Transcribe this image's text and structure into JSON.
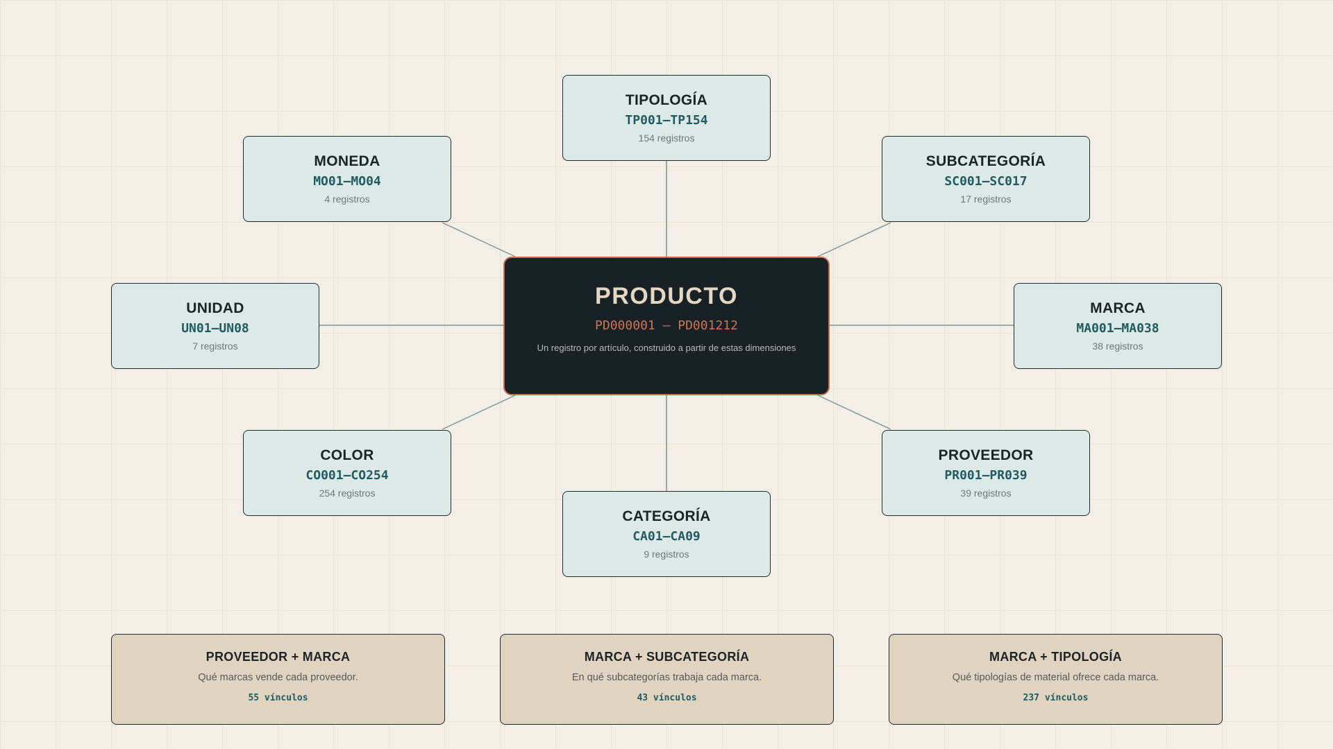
{
  "center": {
    "title": "PRODUCTO",
    "range": "PD000001 – PD001212",
    "description": "Un registro por artículo, construido a partir de estas dimensiones"
  },
  "dimensions": [
    {
      "id": "tipologia",
      "name": "TIPOLOGÍA",
      "range": "TP001–TP154",
      "count": "154 registros"
    },
    {
      "id": "moneda",
      "name": "MONEDA",
      "range": "MO01–MO04",
      "count": "4 registros"
    },
    {
      "id": "subcategoria",
      "name": "SUBCATEGORÍA",
      "range": "SC001–SC017",
      "count": "17 registros"
    },
    {
      "id": "unidad",
      "name": "UNIDAD",
      "range": "UN01–UN08",
      "count": "7 registros"
    },
    {
      "id": "marca",
      "name": "MARCA",
      "range": "MA001–MA038",
      "count": "38 registros"
    },
    {
      "id": "color",
      "name": "COLOR",
      "range": "CO001–CO254",
      "count": "254 registros"
    },
    {
      "id": "proveedor",
      "name": "PROVEEDOR",
      "range": "PR001–PR039",
      "count": "39 registros"
    },
    {
      "id": "categoria",
      "name": "CATEGORÍA",
      "range": "CA01–CA09",
      "count": "9 registros"
    }
  ],
  "relations": [
    {
      "title": "PROVEEDOR + MARCA",
      "description": "Qué marcas vende cada proveedor.",
      "count": "55 vínculos"
    },
    {
      "title": "MARCA + SUBCATEGORÍA",
      "description": "En qué subcategorías trabaja cada marca.",
      "count": "43 vínculos"
    },
    {
      "title": "MARCA + TIPOLOGÍA",
      "description": "Qué tipologías de material ofrece cada marca.",
      "count": "237 vínculos"
    }
  ],
  "colors": {
    "background": "#f4efe6",
    "dimension_fill": "#dde9e7",
    "center_fill": "#172126",
    "center_accent": "#c96a4e",
    "relation_fill": "#e0d3c0",
    "code_text": "#1f5b61",
    "connector": "#7b9396"
  }
}
